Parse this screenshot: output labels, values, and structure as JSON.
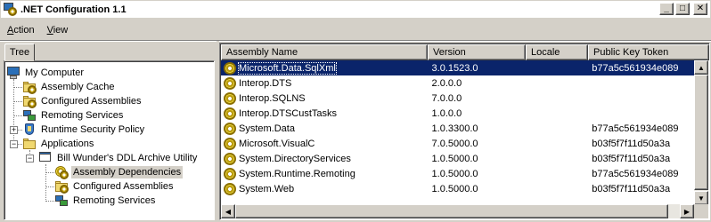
{
  "window": {
    "title": ".NET Configuration 1.1",
    "controls": {
      "minimize": "_",
      "maximize": "□",
      "close": "✕"
    }
  },
  "menu": {
    "items": [
      {
        "label": "Action",
        "accel": "A",
        "rest": "ction"
      },
      {
        "label": "View",
        "accel": "V",
        "rest": "iew"
      }
    ]
  },
  "left_pane": {
    "tab_label": "Tree",
    "tree": [
      {
        "label": "My Computer",
        "icon": "computer-icon"
      },
      {
        "label": "Assembly Cache",
        "icon": "assembly-cache-icon"
      },
      {
        "label": "Configured Assemblies",
        "icon": "configured-assemblies-icon"
      },
      {
        "label": "Remoting Services",
        "icon": "remoting-services-icon"
      },
      {
        "label": "Runtime Security Policy",
        "icon": "security-policy-icon",
        "expander": "+"
      },
      {
        "label": "Applications",
        "icon": "applications-folder-icon",
        "expander": "−"
      },
      {
        "label": "Bill Wunder's DDL Archive Utility",
        "icon": "application-icon",
        "expander": "−"
      },
      {
        "label": "Assembly Dependencies",
        "icon": "assembly-dependencies-icon",
        "selected": true
      },
      {
        "label": "Configured Assemblies",
        "icon": "configured-assemblies-icon"
      },
      {
        "label": "Remoting Services",
        "icon": "remoting-services-icon"
      }
    ]
  },
  "list": {
    "columns": [
      "Assembly Name",
      "Version",
      "Locale",
      "Public Key Token"
    ],
    "rows": [
      {
        "name": "Microsoft.Data.SqlXml",
        "version": "3.0.1523.0",
        "locale": "",
        "token": "b77a5c561934e089",
        "selected": true
      },
      {
        "name": "Interop.DTS",
        "version": "2.0.0.0",
        "locale": "",
        "token": ""
      },
      {
        "name": "Interop.SQLNS",
        "version": "7.0.0.0",
        "locale": "",
        "token": ""
      },
      {
        "name": "Interop.DTSCustTasks",
        "version": "1.0.0.0",
        "locale": "",
        "token": ""
      },
      {
        "name": "System.Data",
        "version": "1.0.3300.0",
        "locale": "",
        "token": "b77a5c561934e089"
      },
      {
        "name": "Microsoft.VisualC",
        "version": "7.0.5000.0",
        "locale": "",
        "token": "b03f5f7f11d50a3a"
      },
      {
        "name": "System.DirectoryServices",
        "version": "1.0.5000.0",
        "locale": "",
        "token": "b03f5f7f11d50a3a"
      },
      {
        "name": "System.Runtime.Remoting",
        "version": "1.0.5000.0",
        "locale": "",
        "token": "b77a5c561934e089"
      },
      {
        "name": "System.Web",
        "version": "1.0.5000.0",
        "locale": "",
        "token": "b03f5f7f11d50a3a"
      }
    ]
  },
  "colors": {
    "selection": "#0a246a",
    "face": "#d4d0c8"
  }
}
